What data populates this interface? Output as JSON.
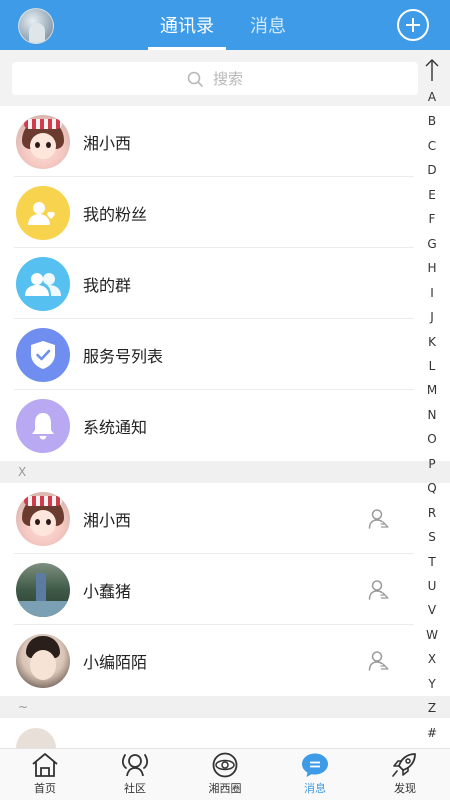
{
  "header": {
    "tabs": [
      {
        "label": "通讯录",
        "active": true
      },
      {
        "label": "消息",
        "active": false
      }
    ]
  },
  "search": {
    "placeholder": "搜索"
  },
  "top_items": [
    {
      "label": "湘小西",
      "icon": "doll-avatar"
    },
    {
      "label": "我的粉丝",
      "icon": "fans-icon",
      "color": "#f7d34e"
    },
    {
      "label": "我的群",
      "icon": "group-icon",
      "color": "#56c0f0"
    },
    {
      "label": "服务号列表",
      "icon": "service-shield-icon",
      "color": "#6f8ef0"
    },
    {
      "label": "系统通知",
      "icon": "bell-icon",
      "color": "#b9a8f2"
    }
  ],
  "sections": [
    {
      "header": "X",
      "contacts": [
        {
          "name": "湘小西",
          "avatar": "doll-avatar"
        },
        {
          "name": "小蠢猪",
          "avatar": "photo-avatar"
        },
        {
          "name": "小编陌陌",
          "avatar": "photo-avatar"
        }
      ]
    },
    {
      "header": "~",
      "contacts": []
    }
  ],
  "index": [
    "A",
    "B",
    "C",
    "D",
    "E",
    "F",
    "G",
    "H",
    "I",
    "J",
    "K",
    "L",
    "M",
    "N",
    "O",
    "P",
    "Q",
    "R",
    "S",
    "T",
    "U",
    "V",
    "W",
    "X",
    "Y",
    "Z",
    "#"
  ],
  "bottom_nav": [
    {
      "label": "首页",
      "icon": "home-icon",
      "active": false
    },
    {
      "label": "社区",
      "icon": "community-icon",
      "active": false
    },
    {
      "label": "湘西圈",
      "icon": "circle-icon",
      "active": false
    },
    {
      "label": "消息",
      "icon": "message-icon",
      "active": true
    },
    {
      "label": "发现",
      "icon": "rocket-icon",
      "active": false
    }
  ],
  "colors": {
    "accent": "#3d9be8",
    "fans": "#f7d34e",
    "group": "#56c0f0",
    "service": "#6f8ef0",
    "notice": "#b9a8f2"
  }
}
